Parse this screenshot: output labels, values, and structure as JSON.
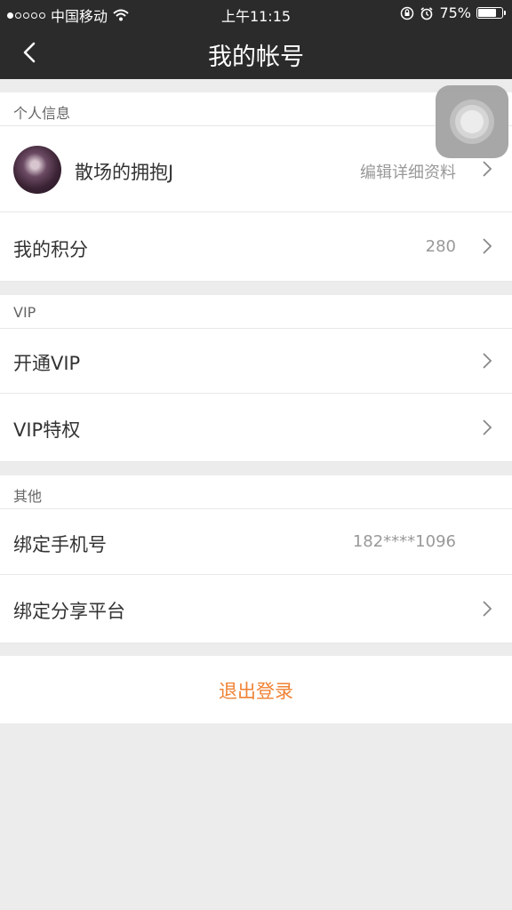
{
  "status_bar": {
    "carrier": "中国移动",
    "time": "上午11:15",
    "battery": "75%",
    "battery_level": 0.75,
    "signal_bars": 1,
    "signal_total": 5
  },
  "nav": {
    "title": "我的帐号",
    "back_icon": "chevron-left-icon"
  },
  "sections": {
    "personal": {
      "header": "个人信息",
      "profile_name": "散场的拥抱J",
      "profile_action": "编辑详细资料",
      "points_label": "我的积分",
      "points_value": "280"
    },
    "vip": {
      "header": "VIP",
      "open_vip": "开通VIP",
      "vip_privileges": "VIP特权"
    },
    "other": {
      "header": "其他",
      "bind_phone_label": "绑定手机号",
      "bind_phone_value": "182****1096",
      "bind_share_label": "绑定分享平台"
    }
  },
  "logout_label": "退出登录",
  "colors": {
    "bar": "#2b2b2b",
    "accent": "#f08234",
    "background": "#ececec"
  }
}
